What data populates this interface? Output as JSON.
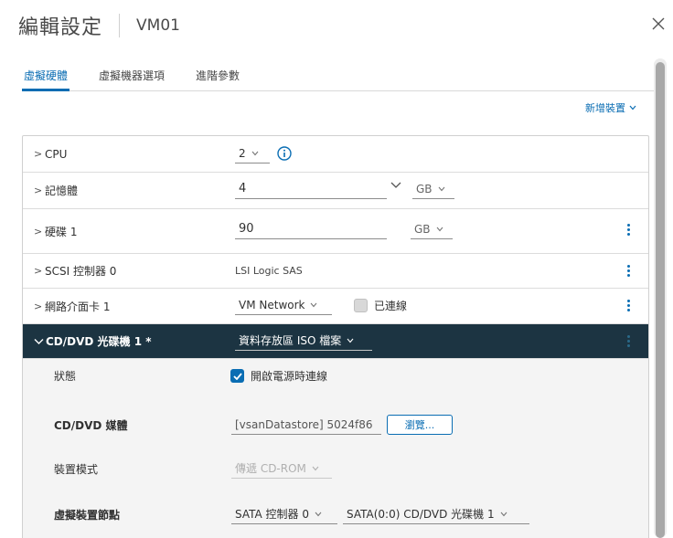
{
  "dialog": {
    "title": "編輯設定",
    "subtitle": "VM01"
  },
  "tabs": [
    {
      "label": "虛擬硬體",
      "active": true
    },
    {
      "label": "虛擬機器選項",
      "active": false
    },
    {
      "label": "進階參數",
      "active": false
    }
  ],
  "add_device": {
    "label": "新增裝置"
  },
  "rows": {
    "cpu": {
      "label": "CPU",
      "value": "2"
    },
    "memory": {
      "label": "記憶體",
      "value": "4",
      "unit": "GB"
    },
    "disk": {
      "label": "硬碟 1",
      "value": "90",
      "unit": "GB"
    },
    "scsi": {
      "label": "SCSI 控制器 0",
      "value": "LSI Logic SAS"
    },
    "nic": {
      "label": "網路介面卡 1",
      "network": "VM Network",
      "connected_label": "已連線",
      "connected": false
    },
    "cdrom": {
      "label": "CD/DVD 光碟機 1 *",
      "source": "資料存放區 ISO 檔案",
      "status_label": "狀態",
      "status_value": "開啟電源時連線",
      "status_checked": true,
      "media_label": "CD/DVD 媒體",
      "media_value": "[vsanDatastore] 5024f86",
      "browse_label": "瀏覽...",
      "mode_label": "裝置模式",
      "mode_value": "傳遞 CD-ROM",
      "node_label": "虛擬裝置節點",
      "node_controller": "SATA 控制器 0",
      "node_slot": "SATA(0:0) CD/DVD 光碟機 1"
    }
  },
  "colors": {
    "accent": "#0a6db3",
    "header_dark": "#1c3442"
  }
}
